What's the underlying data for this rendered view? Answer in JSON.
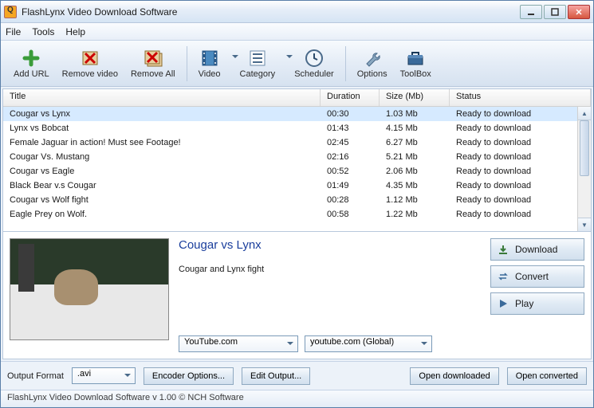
{
  "window": {
    "title": "FlashLynx Video Download Software"
  },
  "menu": {
    "file": "File",
    "tools": "Tools",
    "help": "Help"
  },
  "toolbar": {
    "addurl": "Add URL",
    "removevideo": "Remove video",
    "removeall": "Remove All",
    "video": "Video",
    "category": "Category",
    "scheduler": "Scheduler",
    "options": "Options",
    "toolbox": "ToolBox"
  },
  "columns": {
    "title": "Title",
    "duration": "Duration",
    "size": "Size (Mb)",
    "status": "Status"
  },
  "rows": [
    {
      "title": "Cougar vs Lynx",
      "duration": "00:30",
      "size": "1.03 Mb",
      "status": "Ready to download"
    },
    {
      "title": "Lynx vs Bobcat",
      "duration": "01:43",
      "size": "4.15 Mb",
      "status": "Ready to download"
    },
    {
      "title": "Female Jaguar in action! Must see Footage!",
      "duration": "02:45",
      "size": "6.27 Mb",
      "status": "Ready to download"
    },
    {
      "title": "Cougar Vs. Mustang",
      "duration": "02:16",
      "size": "5.21 Mb",
      "status": "Ready to download"
    },
    {
      "title": "Cougar vs Eagle",
      "duration": "00:52",
      "size": "2.06 Mb",
      "status": "Ready to download"
    },
    {
      "title": "Black Bear v.s Cougar",
      "duration": "01:49",
      "size": "4.35 Mb",
      "status": "Ready to download"
    },
    {
      "title": "Cougar vs Wolf fight",
      "duration": "00:28",
      "size": "1.12 Mb",
      "status": "Ready to download"
    },
    {
      "title": "Eagle Prey on Wolf.",
      "duration": "00:58",
      "size": "1.22 Mb",
      "status": "Ready to download"
    }
  ],
  "detail": {
    "title": "Cougar vs Lynx",
    "desc": "Cougar and Lynx fight",
    "source": "YouTube.com",
    "server": "youtube.com (Global)"
  },
  "actions": {
    "download": "Download",
    "convert": "Convert",
    "play": "Play"
  },
  "bottom": {
    "outputformat_label": "Output Format",
    "outputformat": ".avi",
    "encoder": "Encoder Options...",
    "editoutput": "Edit Output...",
    "opendl": "Open downloaded",
    "openconv": "Open converted"
  },
  "status": "FlashLynx Video Download Software v 1.00 © NCH Software"
}
